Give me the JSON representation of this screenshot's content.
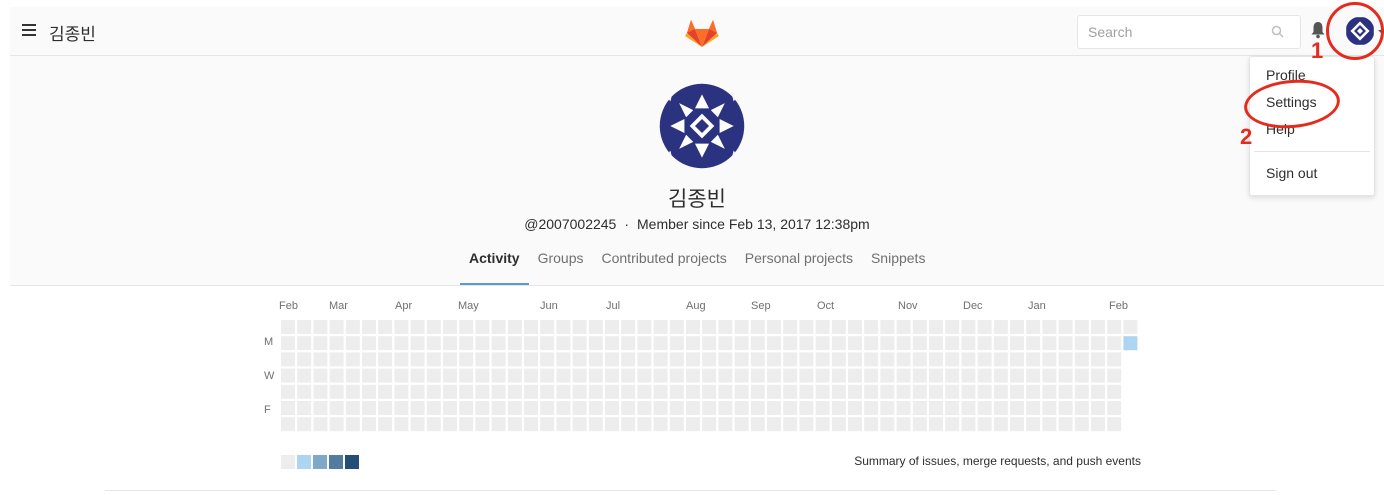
{
  "nav": {
    "title": "김종빈",
    "search_placeholder": "Search",
    "menu_icon": "hamburger-icon",
    "logo_icon": "gitlab-fox-icon",
    "bell_icon": "bell-icon"
  },
  "profile": {
    "name": "김종빈",
    "username": "@2007002245",
    "member_since": "Member since Feb 13, 2017 12:38pm",
    "tabs": [
      {
        "label": "Activity",
        "active": true
      },
      {
        "label": "Groups",
        "active": false
      },
      {
        "label": "Contributed projects",
        "active": false
      },
      {
        "label": "Personal projects",
        "active": false
      },
      {
        "label": "Snippets",
        "active": false
      }
    ]
  },
  "calendar": {
    "months": [
      "Feb",
      "Mar",
      "Apr",
      "May",
      "Jun",
      "Jul",
      "Aug",
      "Sep",
      "Oct",
      "Nov",
      "Dec",
      "Jan",
      "Feb"
    ],
    "day_labels": [
      "M",
      "W",
      "F"
    ],
    "weeks": 53,
    "active_cells": [
      {
        "week": 52,
        "day": 1,
        "level": 1
      }
    ],
    "legend_colors": [
      "#ededed",
      "#acd5f2",
      "#7fa8c9",
      "#527ba0",
      "#254e77"
    ],
    "summary": "Summary of issues, merge requests, and push events"
  },
  "dropdown": {
    "items": [
      "Profile",
      "Settings",
      "Help",
      "Sign out"
    ]
  },
  "annotations": {
    "step1": "1",
    "step2": "2"
  },
  "colors": {
    "accent_tab": "#5b9bd5",
    "annotation_red": "#e42b1e",
    "avatar_navy": "#2b3380"
  }
}
